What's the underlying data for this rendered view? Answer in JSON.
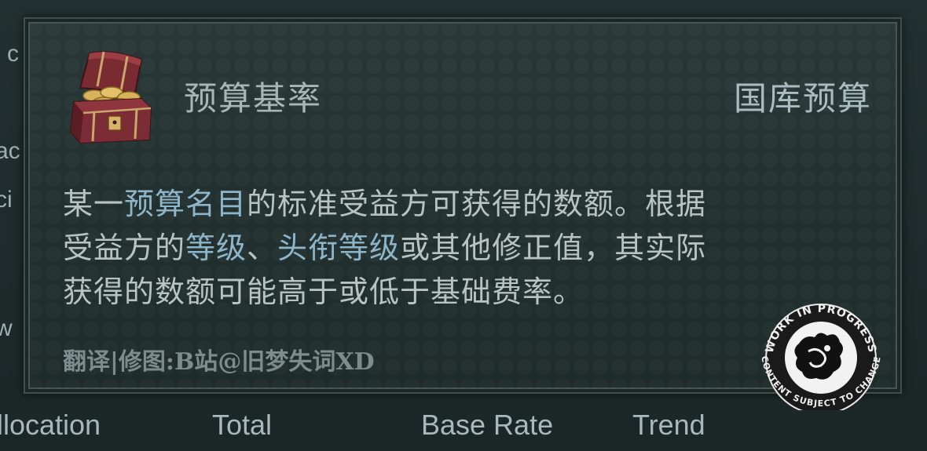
{
  "tooltip": {
    "title_left": "预算基率",
    "title_right": "国库预算",
    "description": {
      "line1": {
        "p1": "某一",
        "hl1": "预算名目",
        "p2": "的标准受益方可获得的数额。根据"
      },
      "line2": {
        "p1": "受益方的",
        "hl1": "等级",
        "p2": "、",
        "hl2": "头衔等级",
        "p3": "或其他修正值，其实际"
      },
      "line3": {
        "p1": "获得的数额可能高于或低于基础费率。"
      }
    },
    "credit": "翻译|修图:B站@旧梦失词XD",
    "icon": "treasure-chest-icon"
  },
  "background": {
    "left_fragments": [
      "l c",
      "ac",
      "ci",
      "w"
    ],
    "column_headers": [
      "llocation",
      "Total",
      "Base Rate",
      "Trend"
    ]
  },
  "badge": {
    "top_text": "WORK IN PROGRESS",
    "bottom_text": "CONTENT SUBJECT TO CHANGE"
  },
  "colors": {
    "tooltip_bg": "#223130",
    "text": "#b9c3c3",
    "highlight": "#8fb5c9",
    "header_text": "#a8b8bb"
  }
}
